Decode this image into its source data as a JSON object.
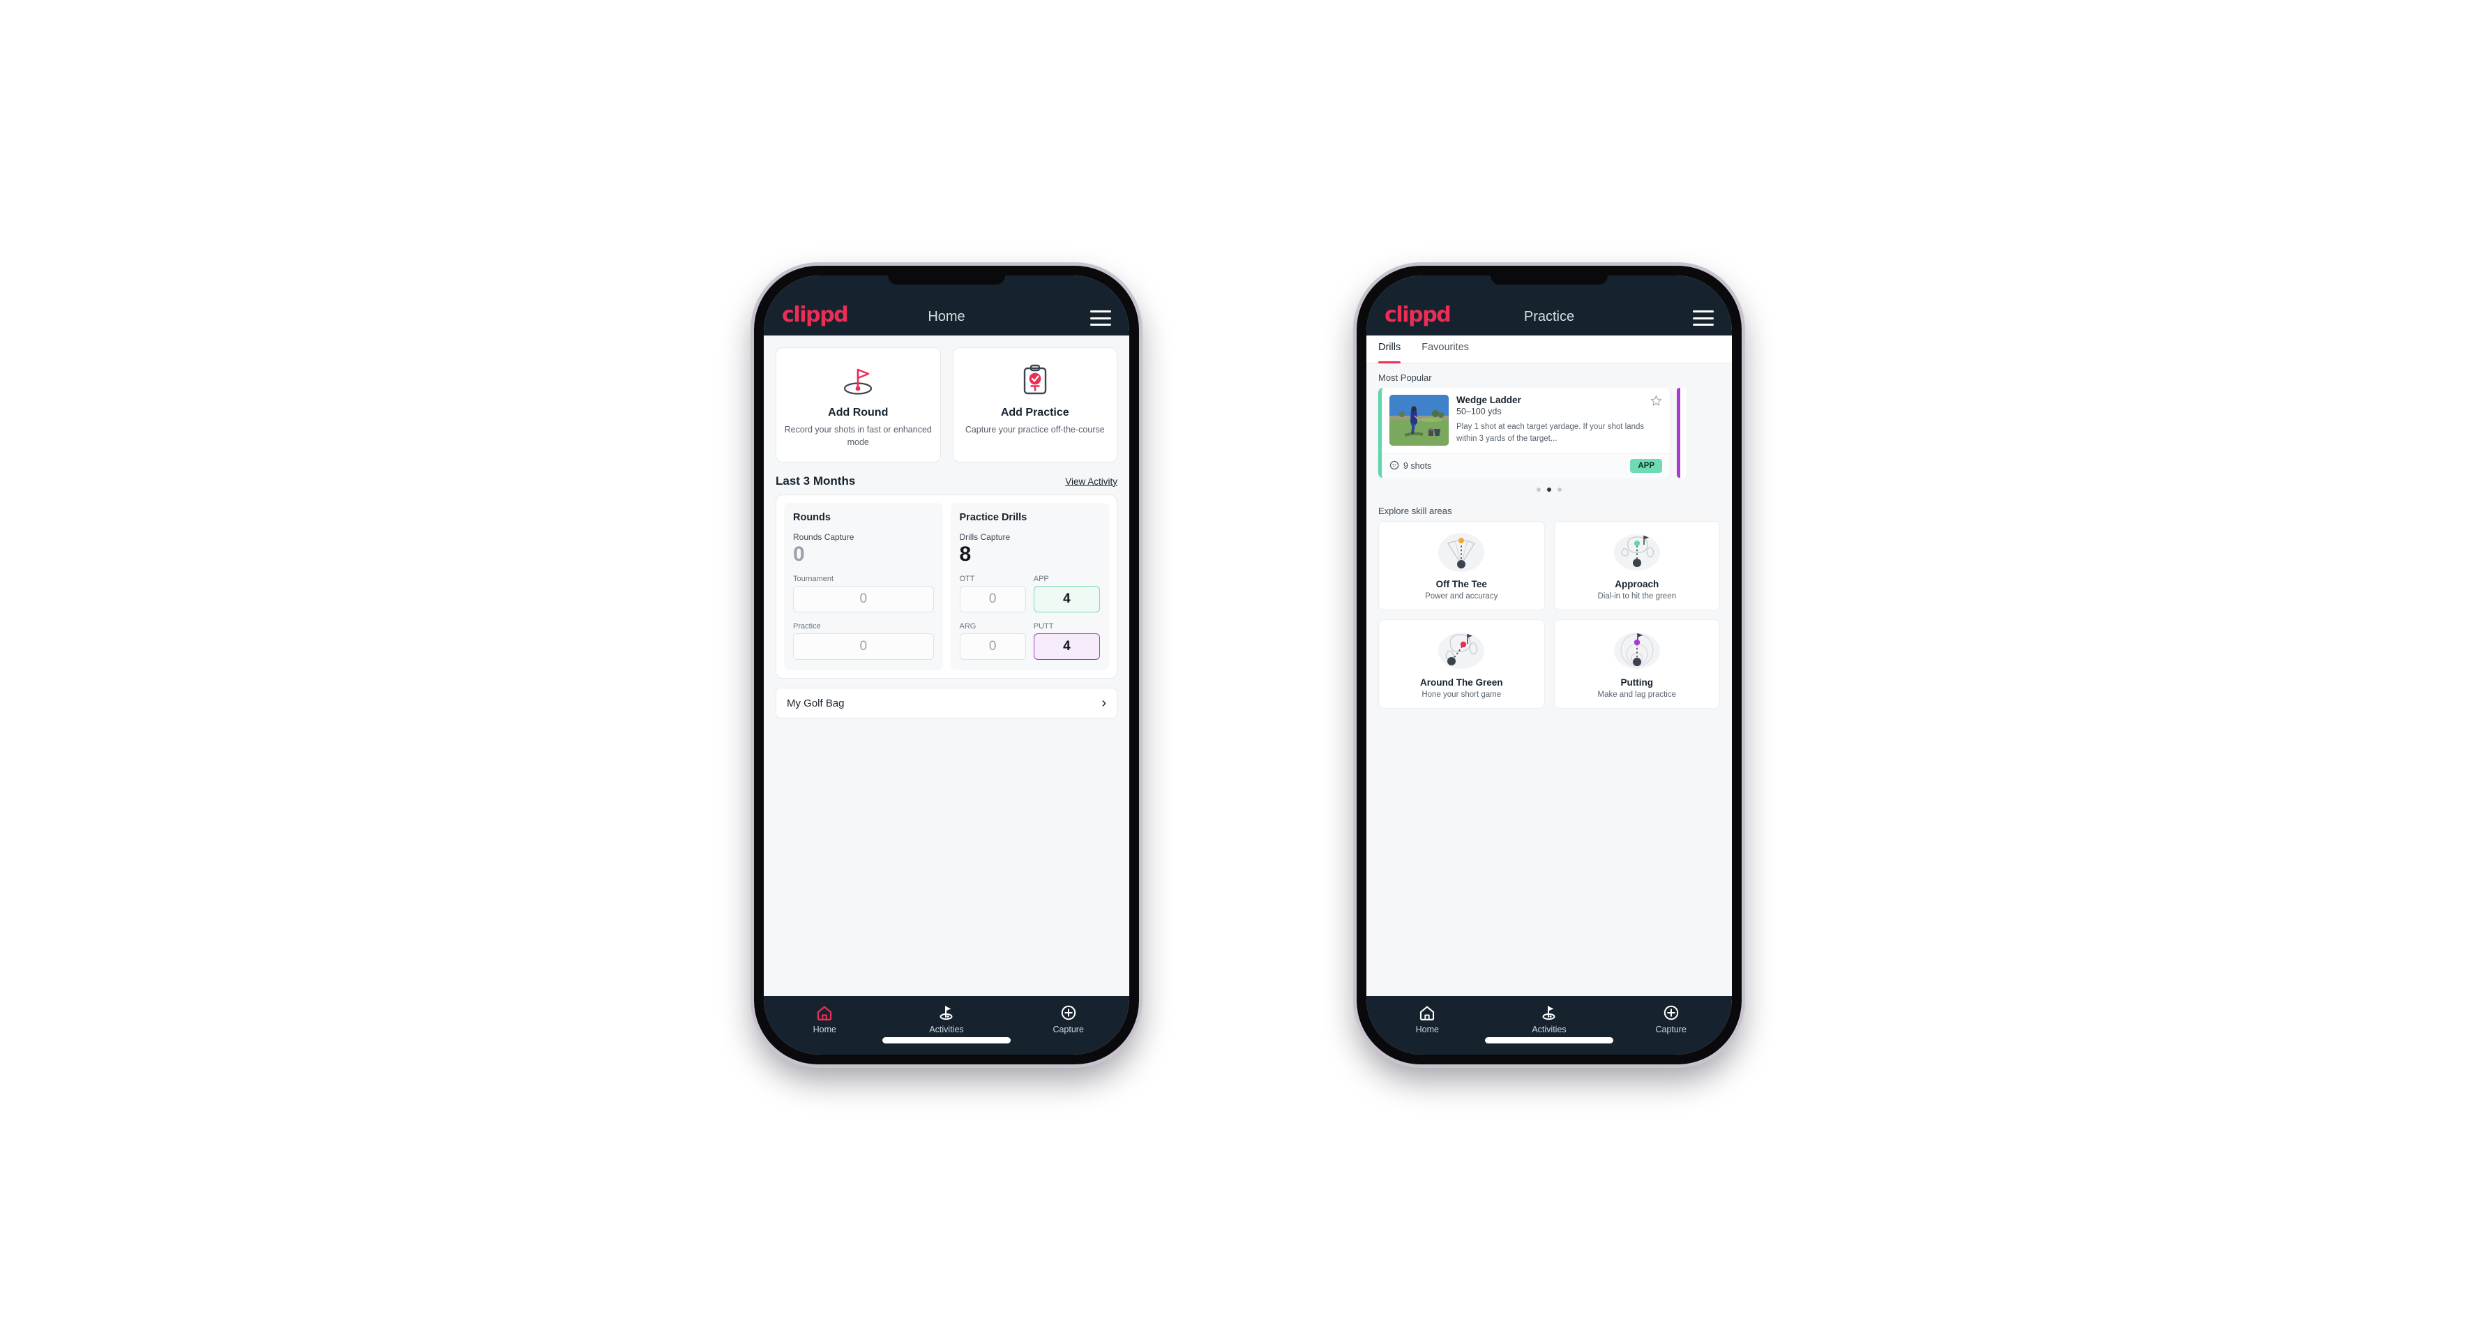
{
  "brand": "clippd",
  "colors": {
    "accent_pink": "#ec2e55",
    "dark_navy": "#16232e",
    "app_green": "#6fdbb3",
    "putt_purple": "#a63bd1",
    "ott_yellow": "#f0ab33"
  },
  "home_phone": {
    "appbar": {
      "title": "Home",
      "menu_icon": "hamburger-icon"
    },
    "actions": [
      {
        "icon": "golf-flag-hole-icon",
        "title": "Add Round",
        "subtitle": "Record your shots in fast or enhanced mode"
      },
      {
        "icon": "clipboard-check-tee-icon",
        "title": "Add Practice",
        "subtitle": "Capture your practice off-the-course"
      }
    ],
    "section": {
      "title": "Last 3 Months",
      "link": "View Activity"
    },
    "stats": {
      "rounds": {
        "heading": "Rounds",
        "capture_label": "Rounds Capture",
        "capture_value": "0",
        "fields": [
          {
            "label": "Tournament",
            "value": "0",
            "state": "empty"
          },
          {
            "label": "Practice",
            "value": "0",
            "state": "empty"
          }
        ]
      },
      "drills": {
        "heading": "Practice Drills",
        "capture_label": "Drills Capture",
        "capture_value": "8",
        "fields": [
          {
            "label": "OTT",
            "value": "0",
            "state": "empty"
          },
          {
            "label": "APP",
            "value": "4",
            "state": "app"
          },
          {
            "label": "ARG",
            "value": "0",
            "state": "empty"
          },
          {
            "label": "PUTT",
            "value": "4",
            "state": "putt"
          }
        ]
      }
    },
    "golf_bag": {
      "label": "My Golf Bag",
      "chevron": "chevron-right-icon"
    },
    "bottom_nav": [
      {
        "icon": "home-icon",
        "label": "Home",
        "active": true
      },
      {
        "icon": "golf-flag-icon",
        "label": "Activities",
        "active": false
      },
      {
        "icon": "plus-circle-icon",
        "label": "Capture",
        "active": false
      }
    ]
  },
  "practice_phone": {
    "appbar": {
      "title": "Practice",
      "menu_icon": "hamburger-icon"
    },
    "tabs": [
      {
        "label": "Drills",
        "active": true
      },
      {
        "label": "Favourites",
        "active": false
      }
    ],
    "most_popular": {
      "heading": "Most Popular",
      "drill": {
        "thumbnail": "golfer-wedge-shot-photo",
        "title": "Wedge Ladder",
        "yardage": "50–100 yds",
        "description": "Play 1 shot at each target yardage. If your shot lands within 3 yards of the target...",
        "favourite_icon": "star-outline-icon",
        "shots_icon": "shot-count-icon",
        "shots": "9 shots",
        "badge": "APP"
      },
      "pagination": {
        "count": 3,
        "active_index": 1
      }
    },
    "explore": {
      "heading": "Explore skill areas",
      "cards": [
        {
          "illustration": "tee-fan-icon",
          "title": "Off The Tee",
          "subtitle": "Power and accuracy"
        },
        {
          "illustration": "green-approach-icon",
          "title": "Approach",
          "subtitle": "Dial-in to hit the green"
        },
        {
          "illustration": "chip-around-green-icon",
          "title": "Around The Green",
          "subtitle": "Hone your short game"
        },
        {
          "illustration": "putting-rings-icon",
          "title": "Putting",
          "subtitle": "Make and lag practice"
        }
      ]
    },
    "bottom_nav": [
      {
        "icon": "home-icon",
        "label": "Home",
        "active": false
      },
      {
        "icon": "golf-flag-icon",
        "label": "Activities",
        "active": false
      },
      {
        "icon": "plus-circle-icon",
        "label": "Capture",
        "active": false
      }
    ]
  }
}
